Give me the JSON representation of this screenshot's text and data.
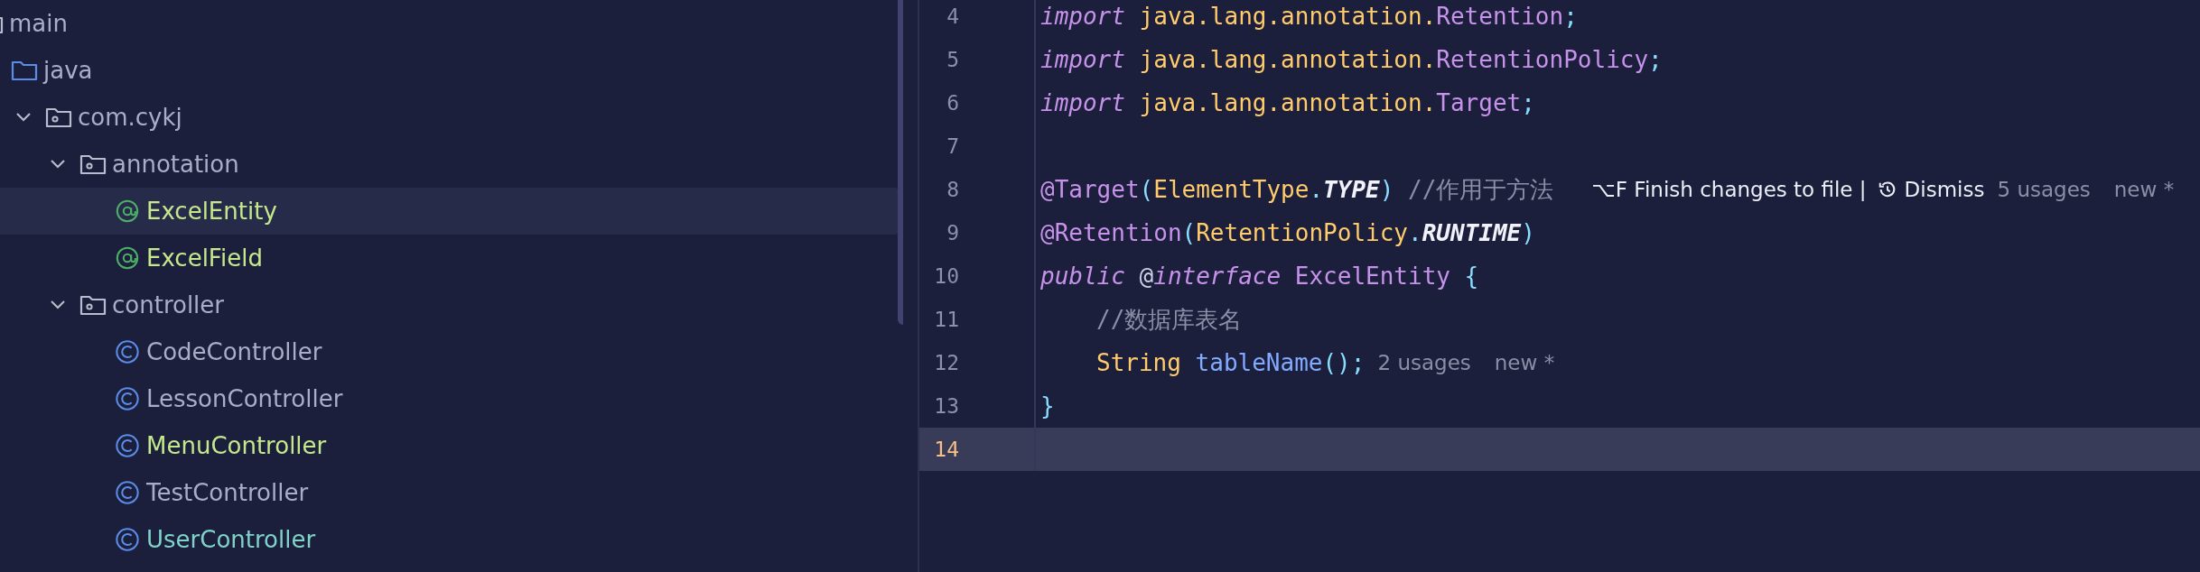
{
  "project_tree": {
    "items": [
      {
        "label": "main",
        "kind": "folder",
        "selected": false,
        "color": "#a9aec8",
        "children": [
          {
            "label": "java",
            "kind": "source-folder",
            "selected": false,
            "color": "#a9aec8",
            "children": [
              {
                "label": "com.cykj",
                "kind": "package",
                "expanded": true,
                "selected": false,
                "color": "#a9aec8",
                "children": [
                  {
                    "label": "annotation",
                    "kind": "package",
                    "expanded": true,
                    "selected": false,
                    "color": "#a9aec8",
                    "children": [
                      {
                        "label": "ExcelEntity",
                        "kind": "annotation",
                        "selected": true,
                        "color": "#c6e88c"
                      },
                      {
                        "label": "ExcelField",
                        "kind": "annotation",
                        "selected": false,
                        "color": "#c6e88c"
                      }
                    ]
                  },
                  {
                    "label": "controller",
                    "kind": "package",
                    "expanded": true,
                    "selected": false,
                    "color": "#a9aec8",
                    "children": [
                      {
                        "label": "CodeController",
                        "kind": "class",
                        "selected": false,
                        "color": "#a9aec8"
                      },
                      {
                        "label": "LessonController",
                        "kind": "class",
                        "selected": false,
                        "color": "#a9aec8"
                      },
                      {
                        "label": "MenuController",
                        "kind": "class",
                        "selected": false,
                        "color": "#c6e88c"
                      },
                      {
                        "label": "TestController",
                        "kind": "class",
                        "selected": false,
                        "color": "#a9aec8"
                      },
                      {
                        "label": "UserController",
                        "kind": "class",
                        "selected": false,
                        "color": "#7fd3c9"
                      }
                    ]
                  }
                ]
              }
            ]
          }
        ]
      }
    ]
  },
  "editor": {
    "lines": [
      {
        "number": "4",
        "current": false,
        "indented": false,
        "tokens": [
          {
            "text": "import",
            "kind": "keyword"
          },
          {
            "text": " java.lang.annotation.",
            "kind": "package"
          },
          {
            "text": "Retention",
            "kind": "classref"
          },
          {
            "text": ";",
            "kind": "punct"
          }
        ]
      },
      {
        "number": "5",
        "current": false,
        "indented": false,
        "tokens": [
          {
            "text": "import",
            "kind": "keyword"
          },
          {
            "text": " java.lang.annotation.",
            "kind": "package"
          },
          {
            "text": "RetentionPolicy",
            "kind": "classref"
          },
          {
            "text": ";",
            "kind": "punct"
          }
        ]
      },
      {
        "number": "6",
        "current": false,
        "indented": false,
        "tokens": [
          {
            "text": "import",
            "kind": "keyword"
          },
          {
            "text": " java.lang.annotation.",
            "kind": "package"
          },
          {
            "text": "Target",
            "kind": "classref"
          },
          {
            "text": ";",
            "kind": "punct"
          }
        ]
      },
      {
        "number": "7",
        "current": false
      },
      {
        "number": "8",
        "current": false,
        "indented": false,
        "tokens": [
          {
            "text": "@Target",
            "kind": "annotation"
          },
          {
            "text": "(",
            "kind": "punct"
          },
          {
            "text": "ElementType",
            "kind": "type"
          },
          {
            "text": ".",
            "kind": "punct"
          },
          {
            "text": "TYPE",
            "kind": "constant"
          },
          {
            "text": ")",
            "kind": "punct"
          },
          {
            "text": " //作用于方法",
            "kind": "comment"
          },
          {
            "text": "⌥F Finish changes to file |",
            "kind": "action"
          },
          {
            "text": "Dismiss",
            "kind": "dismiss"
          },
          {
            "text": "5 usages",
            "kind": "hint"
          },
          {
            "text": "new *",
            "kind": "hint"
          }
        ]
      },
      {
        "number": "9",
        "current": false,
        "indented": false,
        "tokens": [
          {
            "text": "@Retention",
            "kind": "annotation"
          },
          {
            "text": "(",
            "kind": "punct"
          },
          {
            "text": "RetentionPolicy",
            "kind": "type"
          },
          {
            "text": ".",
            "kind": "punct"
          },
          {
            "text": "RUNTIME",
            "kind": "constant"
          },
          {
            "text": ")",
            "kind": "punct"
          }
        ]
      },
      {
        "number": "10",
        "current": false,
        "indented": false,
        "tokens": [
          {
            "text": "public",
            "kind": "keyword"
          },
          {
            "text": " @",
            "kind": "plain"
          },
          {
            "text": "interface",
            "kind": "keyword"
          },
          {
            "text": " ExcelEntity",
            "kind": "classref"
          },
          {
            "text": " {",
            "kind": "punct"
          }
        ]
      },
      {
        "number": "11",
        "current": false,
        "indented": true,
        "tokens": [
          {
            "text": "//数据库表名",
            "kind": "comment"
          }
        ]
      },
      {
        "number": "12",
        "current": false,
        "indented": true,
        "tokens": [
          {
            "text": "String",
            "kind": "type"
          },
          {
            "text": " tableName",
            "kind": "method"
          },
          {
            "text": "();",
            "kind": "punct"
          },
          {
            "text": "2 usages",
            "kind": "hint"
          },
          {
            "text": "new *",
            "kind": "hint"
          }
        ]
      },
      {
        "number": "13",
        "current": false,
        "indented": false,
        "tokens": [
          {
            "text": "}",
            "kind": "punct"
          }
        ]
      },
      {
        "number": "14",
        "current": true
      }
    ]
  }
}
